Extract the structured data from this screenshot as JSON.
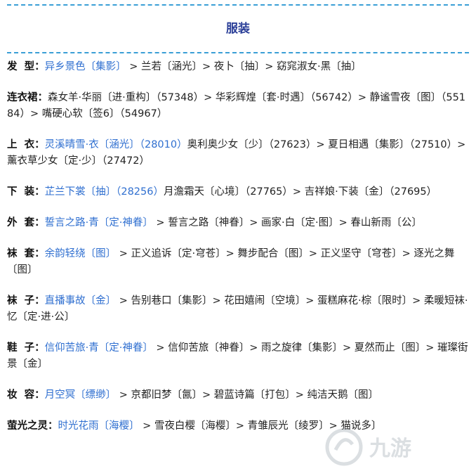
{
  "title": "服装",
  "rows": [
    {
      "label": "发  型",
      "parts": [
        {
          "t": "异乡景色〔集影〕",
          "link": true
        },
        {
          "t": " > 兰若〔涵光〕> 夜卜〔抽〕> 窈窕淑女·黑〔抽〕",
          "link": false
        }
      ]
    },
    {
      "label": "连衣裙",
      "parts": [
        {
          "t": "森女羊·华丽〔进·重构〕（57348）> 华彩辉煌〔套·时遇〕（56742）> 静谧雪夜〔图〕（55184）> 嘴硬心软〔签6〕（54967）",
          "link": false
        }
      ]
    },
    {
      "label": "上  衣",
      "parts": [
        {
          "t": "灵溪晴雪·衣〔涵光〕（28010）",
          "link": true
        },
        {
          "t": "奥利奥少女〔少〕（27623）> 夏日相遇〔集影〕（27510）> 薰衣草少女〔定·少〕（27472）",
          "link": false
        }
      ]
    },
    {
      "label": "下  装",
      "parts": [
        {
          "t": "芷兰下裳〔抽〕（28256）",
          "link": true
        },
        {
          "t": "月澹霜天〔心境〕（27765）> 吉祥娘·下装〔金〕（27695）",
          "link": false
        }
      ]
    },
    {
      "label": "外  套",
      "parts": [
        {
          "t": "誓言之路·青〔定·神眷〕",
          "link": true
        },
        {
          "t": " > 誓言之路〔神眷〕> 画家·白〔定·图〕> 春山新雨〔公〕",
          "link": false
        }
      ]
    },
    {
      "label": "袜  套",
      "parts": [
        {
          "t": "余韵轻绕〔图〕",
          "link": true
        },
        {
          "t": " > 正义追诉〔定·穹苍〕> 舞步配合〔图〕> 正义坚守〔穹苍〕> 逐光之舞〔图〕",
          "link": false
        }
      ]
    },
    {
      "label": "袜  子",
      "parts": [
        {
          "t": "直播事故〔金〕",
          "link": true
        },
        {
          "t": " > 告别巷口〔集影〕> 花田嬉闹〔空境〕> 蛋糕麻花·棕〔限时〕> 柔暖短袜·忆〔定·进·公〕",
          "link": false
        }
      ]
    },
    {
      "label": "鞋  子",
      "parts": [
        {
          "t": "信仰苦旅·青〔定·神眷〕",
          "link": true
        },
        {
          "t": " > 信仰苦旅〔神眷〕> 雨之旋律〔集影〕> 夏然而止〔图〕> 璀璨街景〔金〕",
          "link": false
        }
      ]
    },
    {
      "label": "妆  容",
      "parts": [
        {
          "t": "月空冥〔缥缈〕",
          "link": true
        },
        {
          "t": " > 京都旧梦〔氤〕> 碧蓝诗篇〔打包〕> 纯洁天鹅〔图〕",
          "link": false
        }
      ]
    },
    {
      "label": "萤光之灵",
      "parts": [
        {
          "t": "时光花雨〔海樱〕",
          "link": true
        },
        {
          "t": " > 雪夜白樱〔海樱〕> 青雏辰光〔绫罗〕> 猫说多〕",
          "link": false
        }
      ]
    }
  ],
  "watermark": {
    "text": "九游"
  }
}
